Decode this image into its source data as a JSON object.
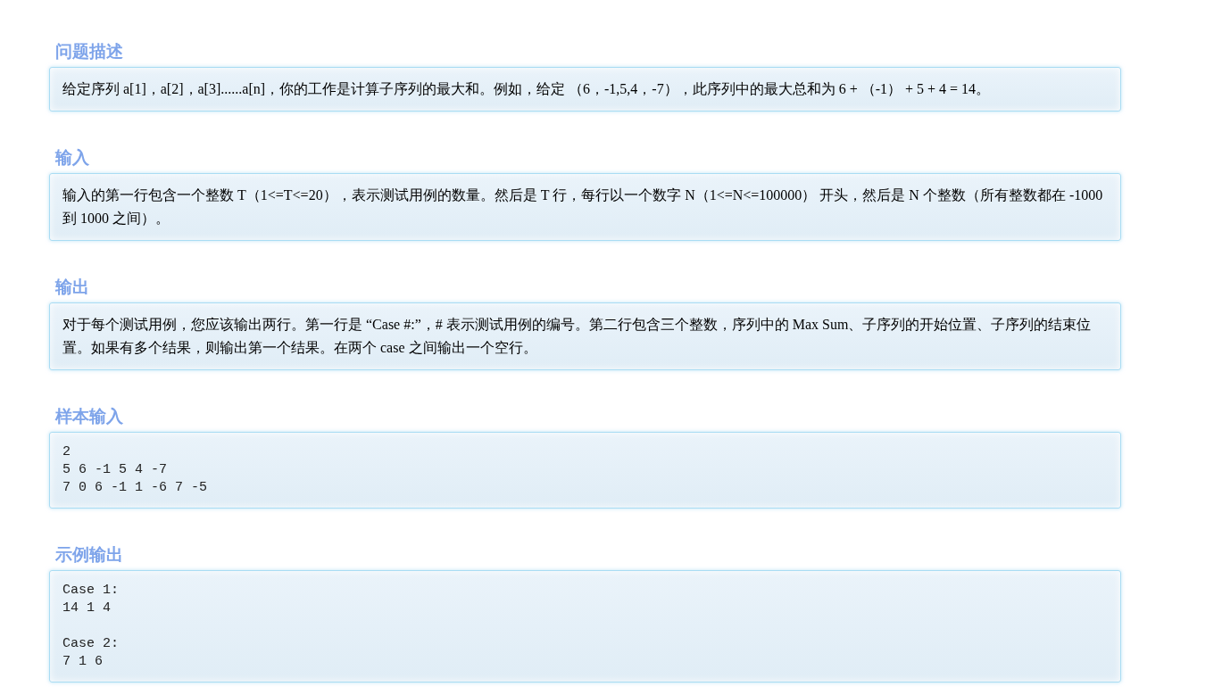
{
  "sections": [
    {
      "heading": "问题描述",
      "kind": "text",
      "body": "给定序列 a[1]，a[2]，a[3]......a[n]，你的工作是计算子序列的最大和。例如，给定 （6，-1,5,4，-7），此序列中的最大总和为 6 + （-1） + 5 + 4 = 14。"
    },
    {
      "heading": "输入",
      "kind": "text",
      "body": "输入的第一行包含一个整数 T（1<=T<=20），表示测试用例的数量。然后是 T 行，每行以一个数字 N（1<=N<=100000） 开头，然后是 N 个整数（所有整数都在 -1000 到 1000 之间）。"
    },
    {
      "heading": "输出",
      "kind": "text",
      "body": "对于每个测试用例，您应该输出两行。第一行是 “Case #:”，# 表示测试用例的编号。第二行包含三个整数，序列中的 Max Sum、子序列的开始位置、子序列的结束位置。如果有多个结果，则输出第一个结果。在两个 case 之间输出一个空行。"
    },
    {
      "heading": "样本输入",
      "kind": "code",
      "body": "2\n5 6 -1 5 4 -7\n7 0 6 -1 1 -6 7 -5"
    },
    {
      "heading": "示例输出",
      "kind": "code",
      "body": "Case 1:\n14 1 4\n\nCase 2:\n7 1 6"
    }
  ]
}
